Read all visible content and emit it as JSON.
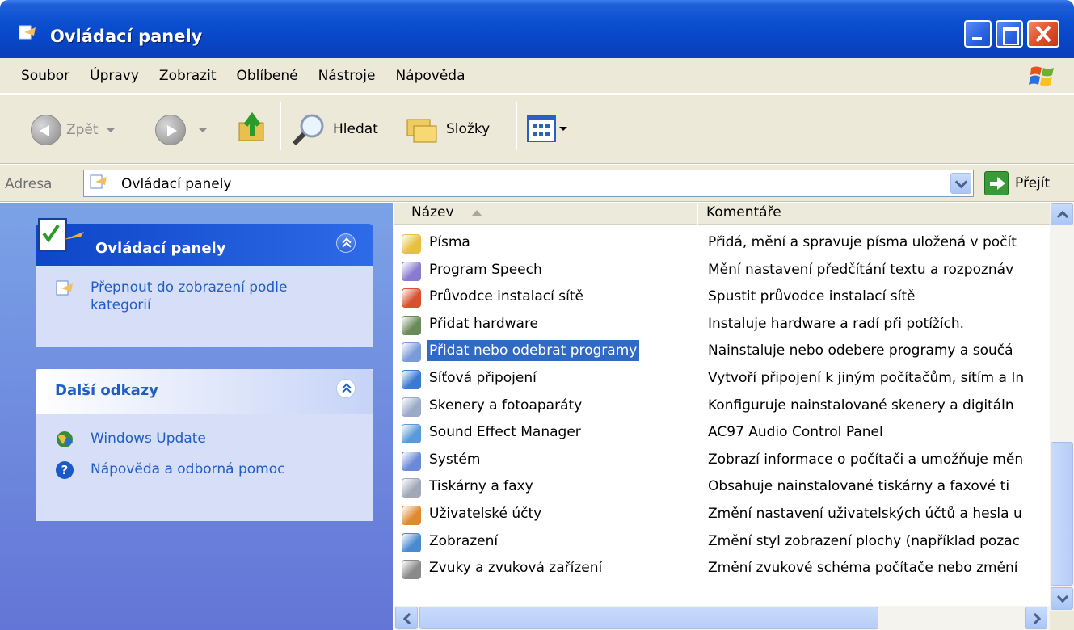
{
  "window": {
    "title": "Ovládací panely",
    "icon": "control-panel-icon"
  },
  "menu": [
    "Soubor",
    "Úpravy",
    "Zobrazit",
    "Oblíbené",
    "Nástroje",
    "Nápověda"
  ],
  "toolbar": {
    "back_label": "Zpět",
    "search_label": "Hledat",
    "folders_label": "Složky"
  },
  "address": {
    "label": "Adresa",
    "value": "Ovládací panely",
    "go_label": "Přejít"
  },
  "leftpane": {
    "panel1": {
      "title": "Ovládací panely",
      "link": "Přepnout do zobrazení podle kategorií"
    },
    "panel2": {
      "title": "Další odkazy",
      "links": [
        "Windows Update",
        "Nápověda a odborná pomoc"
      ]
    }
  },
  "list": {
    "columns": [
      "Název",
      "Komentáře"
    ],
    "rows": [
      {
        "name": "Písma",
        "comment": "Přidá, mění a spravuje písma uložená v počít",
        "icon": "fonts-icon",
        "color": "#e8c040"
      },
      {
        "name": "Program Speech",
        "comment": "Mění nastavení předčítání textu a rozpoznáv",
        "icon": "speech-icon",
        "color": "#8a7ad0"
      },
      {
        "name": "Průvodce instalací sítě",
        "comment": "Spustit průvodce instalací sítě",
        "icon": "network-wizard-icon",
        "color": "#d85030"
      },
      {
        "name": "Přidat hardware",
        "comment": "Instaluje hardware a radí při potížích.",
        "icon": "hardware-icon",
        "color": "#6a8a5a"
      },
      {
        "name": "Přidat nebo odebrat programy",
        "comment": "Nainstaluje nebo odebere programy a součá",
        "icon": "add-remove-programs-icon",
        "color": "#7a9ad8",
        "selected": true
      },
      {
        "name": "Síťová připojení",
        "comment": "Vytvoří připojení k jiným počítačům, sítím a In",
        "icon": "network-connections-icon",
        "color": "#3a7ad0"
      },
      {
        "name": "Skenery a fotoaparáty",
        "comment": "Konfiguruje nainstalované skenery a digitáln",
        "icon": "scanner-icon",
        "color": "#9aaac8"
      },
      {
        "name": "Sound Effect Manager",
        "comment": "AC97 Audio Control Panel",
        "icon": "sound-effect-icon",
        "color": "#5a9ad8"
      },
      {
        "name": "Systém",
        "comment": "Zobrazí informace o počítači a umožňuje měn",
        "icon": "system-icon",
        "color": "#6a8ad8"
      },
      {
        "name": "Tiskárny a faxy",
        "comment": "Obsahuje nainstalované tiskárny a faxové ti",
        "icon": "printer-icon",
        "color": "#a0a8b8"
      },
      {
        "name": "Uživatelské účty",
        "comment": "Změní nastavení uživatelských účtů a hesla u",
        "icon": "user-accounts-icon",
        "color": "#e08a30"
      },
      {
        "name": "Zobrazení",
        "comment": "Změní styl zobrazení plochy (například pozac",
        "icon": "display-icon",
        "color": "#4a8ad0"
      },
      {
        "name": "Zvuky a zvuková zařízení",
        "comment": "Změní zvukové schéma počítače nebo změní",
        "icon": "sounds-icon",
        "color": "#8a8a8a"
      }
    ]
  }
}
